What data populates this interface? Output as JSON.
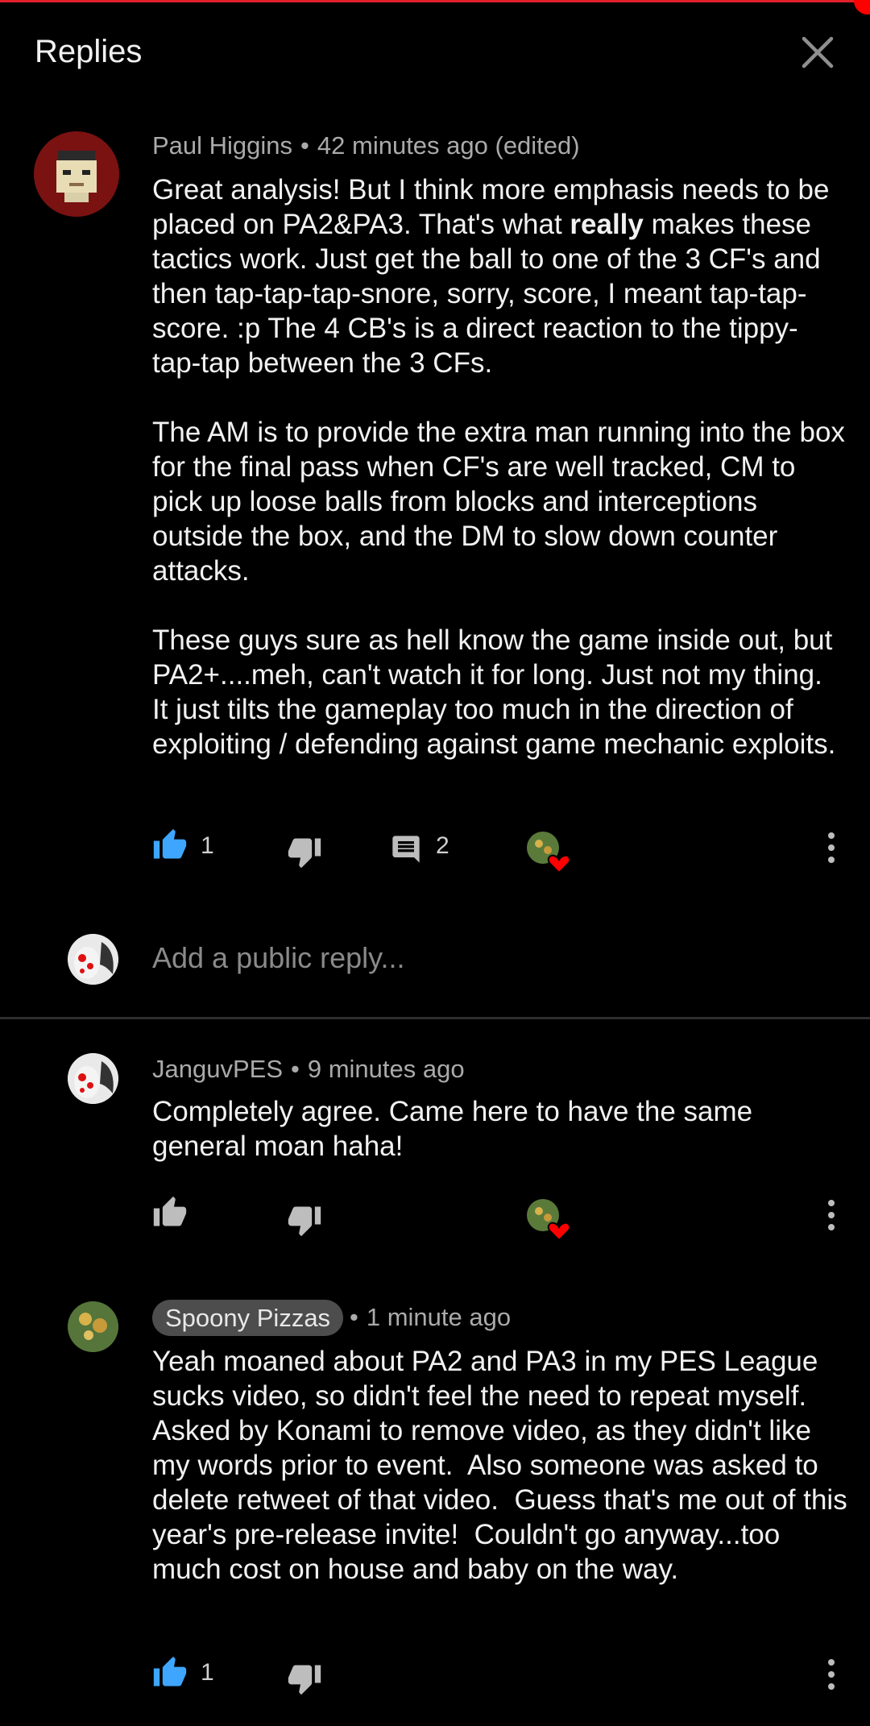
{
  "header": {
    "title": "Replies"
  },
  "comments": [
    {
      "author": "Paul Higgins",
      "sep": "•",
      "time": "42 minutes ago (edited)",
      "text_before": "Great analysis! But I think more emphasis needs to be placed on PA2&PA3. That's what ",
      "text_bold": "really",
      "text_after": " makes these tactics work. Just get the ball to one of the 3 CF's and then tap-tap-tap-snore, sorry, score, I meant tap-tap-score. :p The 4 CB's is a direct reaction to the tippy-tap-tap between the 3 CFs.\n\nThe AM is to provide the extra man running into the box for the final pass when CF's are well tracked, CM to pick up loose balls from blocks and interceptions outside the box, and the DM to slow down counter attacks.\n\nThese guys sure as hell know the game inside out, but PA2+....meh, can't watch it for long. Just not my thing. It just tilts the gameplay too much in the direction of exploiting / defending against game mechanic exploits.",
      "likes": "1",
      "replies": "2"
    },
    {
      "author": "JanguvPES",
      "sep": "•",
      "time": "9 minutes ago",
      "text": "Completely agree. Came here to have the same general moan haha!"
    },
    {
      "author": "Spoony Pizzas",
      "sep": "•",
      "time": "1 minute ago",
      "text": "Yeah moaned about PA2 and PA3 in my PES League sucks video, so didn't feel the need to repeat myself.   Asked by Konami to remove video, as they didn't like my words prior to event.  Also someone was asked to delete retweet of that video.  Guess that's me out of this year's pre-release invite!  Couldn't go anyway...too much cost on house and baby on the way.",
      "likes": "1"
    }
  ],
  "reply_box": {
    "placeholder": "Add a public reply..."
  },
  "colors": {
    "like_active": "#3ea6ff",
    "heart": "#ff0000",
    "icon_gray": "#bdbdbd"
  }
}
